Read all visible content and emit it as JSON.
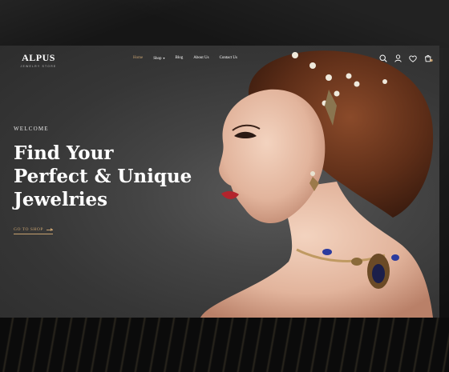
{
  "brand": {
    "name": "ALPUS",
    "tagline": "JEWELRY STORE"
  },
  "nav": {
    "items": [
      {
        "label": "Home",
        "active": true
      },
      {
        "label": "Shop",
        "has_dropdown": true
      },
      {
        "label": "Blog"
      },
      {
        "label": "About Us"
      },
      {
        "label": "Contact Us"
      }
    ]
  },
  "header_icons": [
    "search-icon",
    "user-icon",
    "heart-icon",
    "cart-icon"
  ],
  "hero": {
    "eyebrow": "WELCOME",
    "headline_line1": "Find Your",
    "headline_line2": "Perfect & Unique",
    "headline_line3": "Jewelries",
    "cta": "GO TO SHOP"
  },
  "colors": {
    "accent": "#c8a270",
    "background": "#3d3d3d",
    "text": "#ffffff"
  }
}
